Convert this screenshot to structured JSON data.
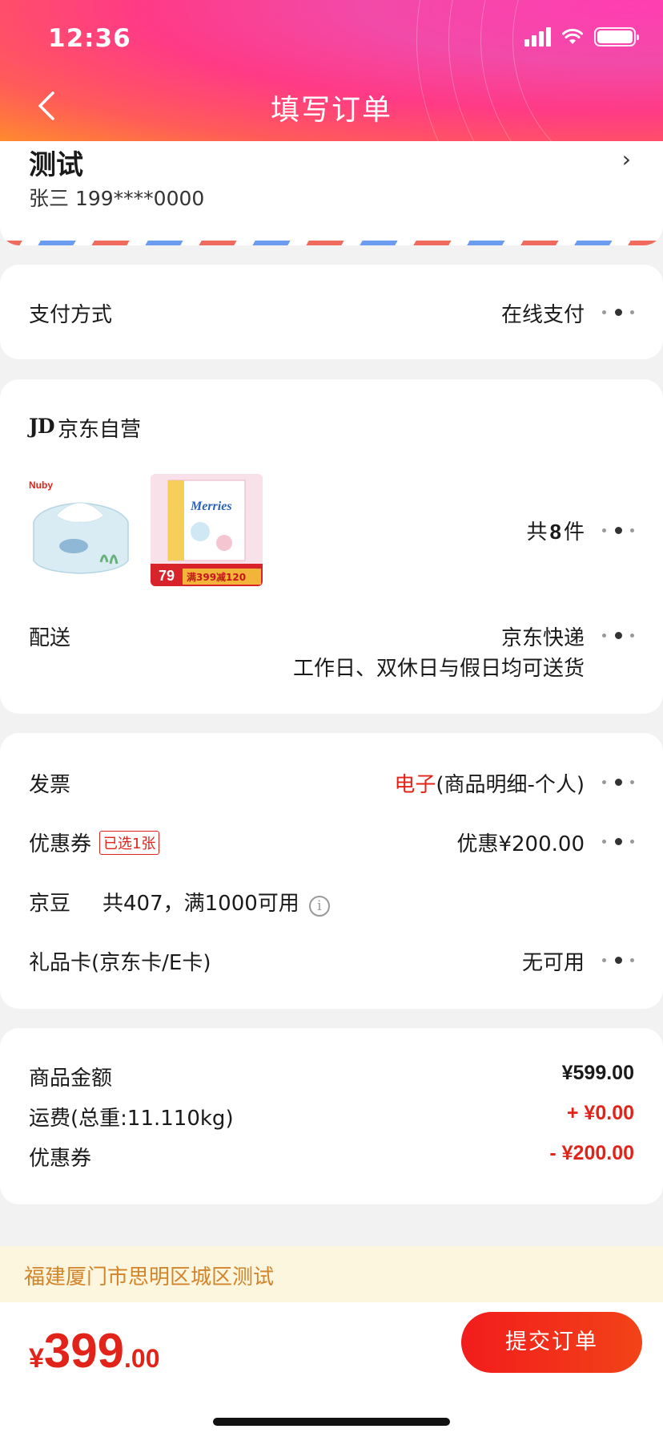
{
  "status_bar": {
    "time": "12:36"
  },
  "nav": {
    "title": "填写订单"
  },
  "address": {
    "name": "测试",
    "contact": "张三  199****0000"
  },
  "payment": {
    "label": "支付方式",
    "value": "在线支付"
  },
  "shop": {
    "logo": "JD",
    "name": "京东自营",
    "item_count_prefix": "共",
    "item_count": "8",
    "item_count_suffix": "件",
    "products": [
      {
        "brand": "Nuby"
      },
      {
        "brand": "Merries",
        "price_badge": "79",
        "promo": "满399减120"
      }
    ]
  },
  "delivery": {
    "label": "配送",
    "carrier": "京东快递",
    "schedule": "工作日、双休日与假日均可送货"
  },
  "invoice": {
    "label": "发票",
    "type": "电子",
    "detail": "(商品明细-个人)"
  },
  "coupon": {
    "label": "优惠券",
    "tag": "已选1张",
    "value": "优惠¥200.00"
  },
  "jingdou": {
    "label": "京豆",
    "info": "共407，满1000可用",
    "icon": "info-icon"
  },
  "giftcard": {
    "label": "礼品卡(京东卡/E卡)",
    "value": "无可用"
  },
  "summary": {
    "goods_label": "商品金额",
    "goods_value": "¥599.00",
    "freight_label": "运费(总重:11.110kg)",
    "freight_value": "+ ¥0.00",
    "coupon_label": "优惠券",
    "coupon_value": "- ¥200.00"
  },
  "notice": {
    "text": "福建厦门市思明区城区测试"
  },
  "bottom": {
    "currency": "¥",
    "total_int": "399",
    "total_dec": ".00",
    "submit_label": "提交订单"
  },
  "colors": {
    "accent": "#e2231a",
    "header_start": "#ff8a2e",
    "header_end": "#ff3fb0",
    "notice_text": "#d2842a"
  }
}
